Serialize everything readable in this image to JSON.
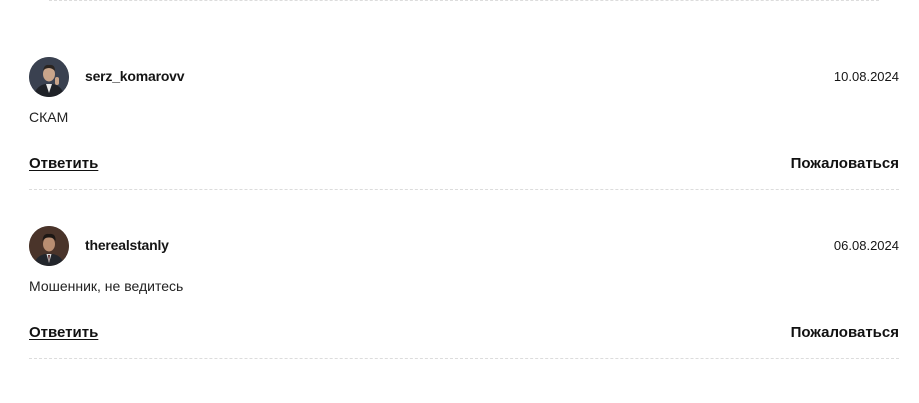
{
  "comments": [
    {
      "username": "serz_komarovv",
      "date": "10.08.2024",
      "text": "СКАМ",
      "reply_label": "Ответить",
      "report_label": "Пожаловаться"
    },
    {
      "username": "therealstanly",
      "date": "06.08.2024",
      "text": "Мошенник, не ведитесь",
      "reply_label": "Ответить",
      "report_label": "Пожаловаться"
    }
  ]
}
